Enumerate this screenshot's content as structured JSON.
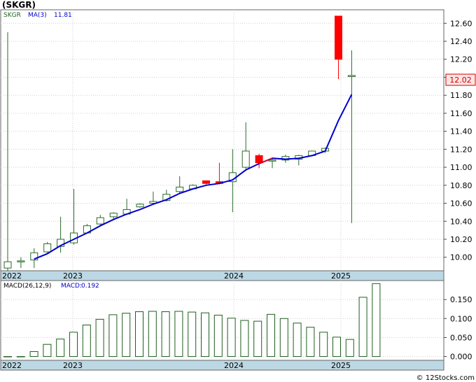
{
  "title": "(SKGR)",
  "watermark": "© 12Stocks.com",
  "colors": {
    "up_candle": "#2a6b2a",
    "down_candle": "#ff0000",
    "ma_line": "#0000cc",
    "macd_bar": "#1f5f1f",
    "axis_band": "#bcd8e4",
    "price_tag_bg": "#ffe4e4",
    "price_tag_fg": "#cc0000"
  },
  "chart_data": [
    {
      "type": "candlestick",
      "legend": {
        "symbol": "SKGR",
        "ma_label": "MA(3)",
        "ma_value": "11.81"
      },
      "last_price": "12.02",
      "ylim": [
        9.85,
        12.75
      ],
      "yticks": [
        "12.60",
        "12.40",
        "12.20",
        "12.00",
        "11.80",
        "11.60",
        "11.40",
        "11.20",
        "11.00",
        "10.80",
        "10.60",
        "10.40",
        "10.20",
        "10.00"
      ],
      "xlabels": [
        "2022",
        "2023",
        "2024",
        "2025"
      ],
      "candles": [
        {
          "o": 9.88,
          "h": 12.5,
          "l": 9.85,
          "c": 9.95,
          "ma": null
        },
        {
          "o": 9.95,
          "h": 10.0,
          "l": 9.88,
          "c": 9.96,
          "ma": null
        },
        {
          "o": 9.97,
          "h": 10.1,
          "l": 9.88,
          "c": 10.05,
          "ma": 9.98
        },
        {
          "o": 10.06,
          "h": 10.17,
          "l": 10.05,
          "c": 10.15,
          "ma": 10.04
        },
        {
          "o": 10.12,
          "h": 10.45,
          "l": 10.05,
          "c": 10.2,
          "ma": 10.13
        },
        {
          "o": 10.16,
          "h": 10.76,
          "l": 10.14,
          "c": 10.27,
          "ma": 10.2
        },
        {
          "o": 10.27,
          "h": 10.37,
          "l": 10.27,
          "c": 10.35,
          "ma": 10.27
        },
        {
          "o": 10.37,
          "h": 10.47,
          "l": 10.36,
          "c": 10.44,
          "ma": 10.35
        },
        {
          "o": 10.45,
          "h": 10.5,
          "l": 10.42,
          "c": 10.49,
          "ma": 10.42
        },
        {
          "o": 10.48,
          "h": 10.65,
          "l": 10.47,
          "c": 10.53,
          "ma": 10.48
        },
        {
          "o": 10.56,
          "h": 10.6,
          "l": 10.55,
          "c": 10.59,
          "ma": 10.53
        },
        {
          "o": 10.6,
          "h": 10.73,
          "l": 10.59,
          "c": 10.62,
          "ma": 10.59
        },
        {
          "o": 10.63,
          "h": 10.75,
          "l": 10.62,
          "c": 10.7,
          "ma": 10.64
        },
        {
          "o": 10.73,
          "h": 10.9,
          "l": 10.7,
          "c": 10.78,
          "ma": 10.71
        },
        {
          "o": 10.76,
          "h": 10.81,
          "l": 10.75,
          "c": 10.8,
          "ma": 10.76
        },
        {
          "o": 10.85,
          "h": 10.85,
          "l": 10.81,
          "c": 10.82,
          "ma": 10.8
        },
        {
          "o": 10.84,
          "h": 11.05,
          "l": 10.81,
          "c": 10.82,
          "ma": 10.82
        },
        {
          "o": 10.84,
          "h": 11.2,
          "l": 10.5,
          "c": 10.94,
          "ma": 10.86
        },
        {
          "o": 11.0,
          "h": 11.5,
          "l": 10.98,
          "c": 11.18,
          "ma": 10.97
        },
        {
          "o": 11.13,
          "h": 11.15,
          "l": 10.99,
          "c": 11.05,
          "ma": 11.04
        },
        {
          "o": 11.08,
          "h": 11.1,
          "l": 10.99,
          "c": 11.08,
          "ma": 11.1
        },
        {
          "o": 11.08,
          "h": 11.14,
          "l": 11.05,
          "c": 11.12,
          "ma": 11.09
        },
        {
          "o": 11.09,
          "h": 11.14,
          "l": 11.02,
          "c": 11.13,
          "ma": 11.1
        },
        {
          "o": 11.13,
          "h": 11.18,
          "l": 11.12,
          "c": 11.18,
          "ma": 11.13
        },
        {
          "o": 11.18,
          "h": 11.22,
          "l": 11.16,
          "c": 11.21,
          "ma": 11.18
        },
        {
          "o": 12.68,
          "h": 12.68,
          "l": 11.98,
          "c": 12.2,
          "ma": 11.52
        },
        {
          "o": 12.01,
          "h": 12.3,
          "l": 10.38,
          "c": 12.02,
          "ma": 11.81
        }
      ]
    },
    {
      "type": "bar",
      "legend": {
        "name": "MACD(26,12,9)",
        "value_label": "MACD:",
        "value": "0.192"
      },
      "ylim": [
        -0.01,
        0.2
      ],
      "yticks": [
        "0.150",
        "0.100",
        "0.050",
        "0.000"
      ],
      "xlabels": [
        "2022",
        "2023",
        "2024",
        "2025"
      ],
      "values": [
        0.0,
        0.0,
        0.013,
        0.032,
        0.046,
        0.064,
        0.083,
        0.098,
        0.11,
        0.114,
        0.118,
        0.119,
        0.118,
        0.119,
        0.117,
        0.115,
        0.109,
        0.101,
        0.095,
        0.093,
        0.111,
        0.1,
        0.088,
        0.077,
        0.064,
        0.051,
        0.045,
        0.156,
        0.192
      ]
    }
  ]
}
